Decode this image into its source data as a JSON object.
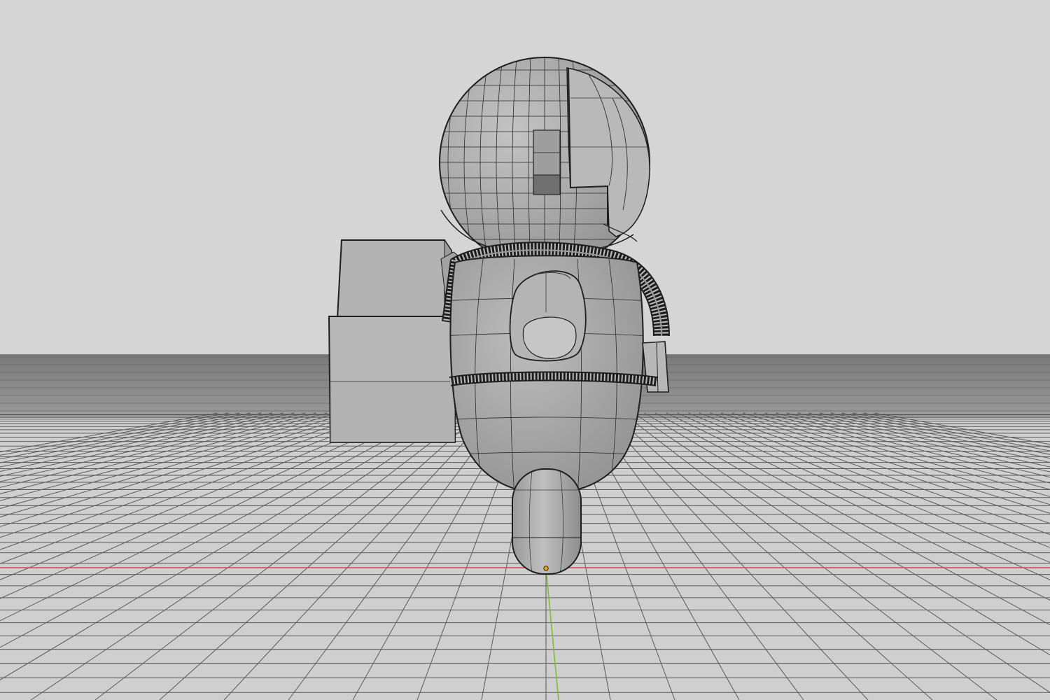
{
  "viewport": {
    "mode": "3D Viewport",
    "shading": "solid-wireframe"
  },
  "colors": {
    "background": "#d5d5d5",
    "horizon_band": "#6f6f6f",
    "floor": "#cdcdcd",
    "grid_line": "#5a5a5a",
    "axis_x": "#d4474e",
    "axis_y": "#7dbb2c",
    "mesh_fill": "#a8a8a8",
    "mesh_edge": "#1e1e1e",
    "origin_point": "#f0a30a"
  },
  "scene": {
    "objects": [
      "astronaut-helmet",
      "astronaut-visor",
      "astronaut-torso",
      "astronaut-backpack",
      "astronaut-air-hose",
      "astronaut-belt",
      "astronaut-side-clip",
      "astronaut-leg"
    ]
  }
}
